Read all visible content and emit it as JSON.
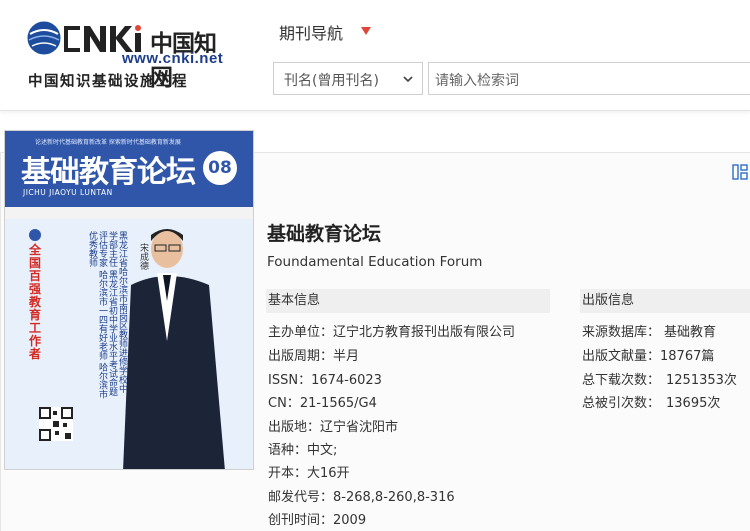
{
  "logo": {
    "wordmark": "CNKI",
    "cn_name": "中国知网",
    "url": "www.cnki.net",
    "tagline": "中国知识基础设施工程"
  },
  "nav": {
    "journal_nav_label": "期刊导航",
    "arrow_icon": "triangle-down-icon",
    "accent_color": "#e0453a"
  },
  "search": {
    "field_select_value": "刊名(曾用刊名)",
    "input_placeholder": "请输入检索词"
  },
  "cover": {
    "top_text": "论述新时代基础教育新改革   探索新时代基础教育新发展",
    "title": "基础教育论坛",
    "pinyin": "JICHU JIAOYU LUNTAN",
    "issue": "08",
    "headline": "全国百强教育工作者",
    "subtitle": "黑龙江省哈尔滨市南岗区教师进修学校中学部主任 黑龙江省初中学业水平考试命题评估专家 哈尔滨市一四有好老师 哈尔滨市优秀教师",
    "person_name": "宋成德",
    "banner_color": "#2f56a8"
  },
  "journal": {
    "title": "基础教育论坛",
    "title_en": "Foundamental Education Forum"
  },
  "basic_info": {
    "heading": "基本信息",
    "rows": [
      {
        "label": "主办单位：",
        "value": "辽宁北方教育报刊出版有限公司"
      },
      {
        "label": "出版周期：",
        "value": "半月"
      },
      {
        "label": "ISSN：",
        "value": "1674-6023"
      },
      {
        "label": "CN：",
        "value": "21-1565/G4"
      },
      {
        "label": "出版地：",
        "value": "辽宁省沈阳市"
      },
      {
        "label": "语种：",
        "value": "中文;"
      },
      {
        "label": "开本：",
        "value": "大16开"
      },
      {
        "label": "邮发代号：",
        "value": "8-268,8-260,8-316"
      },
      {
        "label": "创刊时间：",
        "value": "2009"
      }
    ]
  },
  "pub_info": {
    "heading": "出版信息",
    "rows": [
      {
        "label": "来源数据库：",
        "value": "基础教育"
      },
      {
        "label": "出版文献量：",
        "value": "18767篇"
      },
      {
        "label": "总下载次数：",
        "value": "1251353次"
      },
      {
        "label": "总被引次数：",
        "value": "13695次"
      }
    ]
  },
  "icons": {
    "layout_toggle": "grid-layout-icon",
    "select_chevron": "chevron-down-icon"
  }
}
